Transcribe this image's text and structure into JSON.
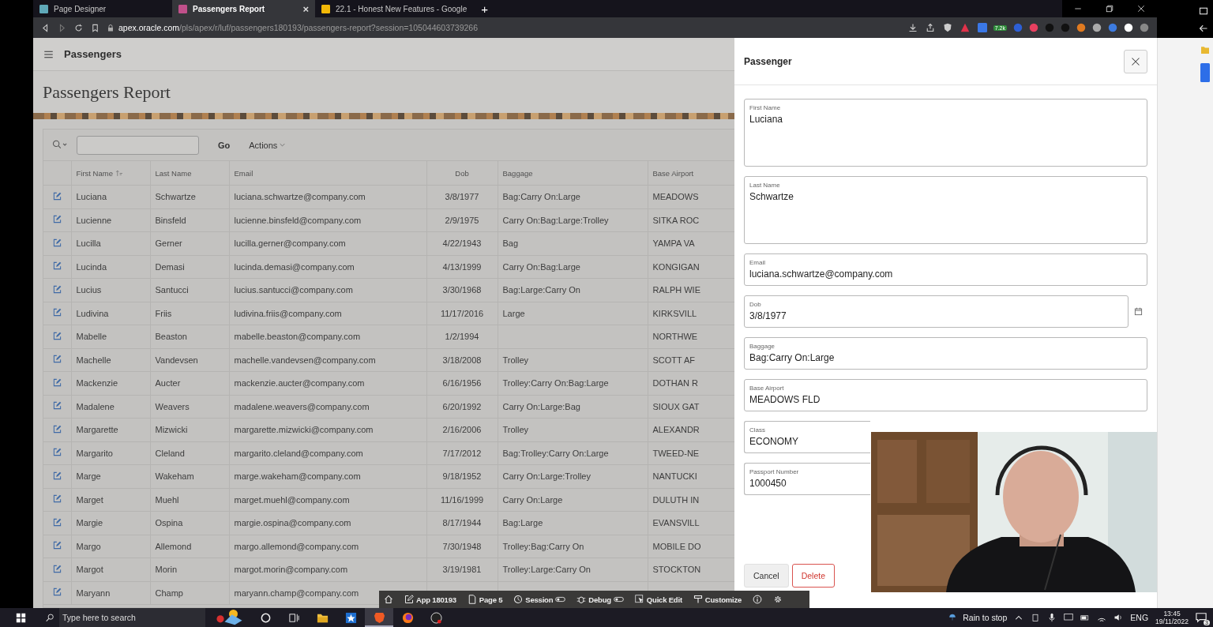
{
  "browser": {
    "tabs": [
      {
        "title": "Page Designer",
        "selected": false
      },
      {
        "title": "Passengers Report",
        "selected": true
      },
      {
        "title": "22.1 - Honest New Features - Google",
        "selected": false
      }
    ],
    "tab_close": "×",
    "new_tab": "+",
    "url": "**apex.oracle.com**/pls/apex/r/luf/passengers180193/passengers-report?session=105044603739266",
    "extension_badge": "7.2k"
  },
  "app": {
    "header_title": "Passengers",
    "page_title": "Passengers Report",
    "go": "Go",
    "actions": "Actions",
    "columns": [
      {
        "label": "First Name",
        "sorted": true
      },
      {
        "label": "Last Name",
        "sorted": false
      },
      {
        "label": "Email",
        "sorted": false
      },
      {
        "label": "Dob",
        "sorted": false
      },
      {
        "label": "Baggage",
        "sorted": false
      },
      {
        "label": "Base Airport",
        "sorted": false
      }
    ],
    "rows": [
      {
        "first_name": "Luciana",
        "last_name": "Schwartze",
        "email": "luciana.schwartze@company.com",
        "dob": "3/8/1977",
        "baggage": "Bag:Carry On:Large",
        "base_airport": "MEADOWS"
      },
      {
        "first_name": "Lucienne",
        "last_name": "Binsfeld",
        "email": "lucienne.binsfeld@company.com",
        "dob": "2/9/1975",
        "baggage": "Carry On:Bag:Large:Trolley",
        "base_airport": "SITKA ROC"
      },
      {
        "first_name": "Lucilla",
        "last_name": "Gerner",
        "email": "lucilla.gerner@company.com",
        "dob": "4/22/1943",
        "baggage": "Bag",
        "base_airport": "YAMPA VA"
      },
      {
        "first_name": "Lucinda",
        "last_name": "Demasi",
        "email": "lucinda.demasi@company.com",
        "dob": "4/13/1999",
        "baggage": "Carry On:Bag:Large",
        "base_airport": "KONGIGAN"
      },
      {
        "first_name": "Lucius",
        "last_name": "Santucci",
        "email": "lucius.santucci@company.com",
        "dob": "3/30/1968",
        "baggage": "Bag:Large:Carry On",
        "base_airport": "RALPH WIE"
      },
      {
        "first_name": "Ludivina",
        "last_name": "Friis",
        "email": "ludivina.friis@company.com",
        "dob": "11/17/2016",
        "baggage": "Large",
        "base_airport": "KIRKSVILL"
      },
      {
        "first_name": "Mabelle",
        "last_name": "Beaston",
        "email": "mabelle.beaston@company.com",
        "dob": "1/2/1994",
        "base_airport": "NORTHWE"
      },
      {
        "first_name": "Machelle",
        "last_name": "Vandevsen",
        "email": "machelle.vandevsen@company.com",
        "dob": "3/18/2008",
        "baggage": "Trolley",
        "base_airport": "SCOTT AF"
      },
      {
        "first_name": "Mackenzie",
        "last_name": "Aucter",
        "email": "mackenzie.aucter@company.com",
        "dob": "6/16/1956",
        "baggage": "Trolley:Carry On:Bag:Large",
        "base_airport": "DOTHAN R"
      },
      {
        "first_name": "Madalene",
        "last_name": "Weavers",
        "email": "madalene.weavers@company.com",
        "dob": "6/20/1992",
        "baggage": "Carry On:Large:Bag",
        "base_airport": "SIOUX GAT"
      },
      {
        "first_name": "Margarette",
        "last_name": "Mizwicki",
        "email": "margarette.mizwicki@company.com",
        "dob": "2/16/2006",
        "baggage": "Trolley",
        "base_airport": "ALEXANDR"
      },
      {
        "first_name": "Margarito",
        "last_name": "Cleland",
        "email": "margarito.cleland@company.com",
        "dob": "7/17/2012",
        "baggage": "Bag:Trolley:Carry On:Large",
        "base_airport": "TWEED-NE"
      },
      {
        "first_name": "Marge",
        "last_name": "Wakeham",
        "email": "marge.wakeham@company.com",
        "dob": "9/18/1952",
        "baggage": "Carry On:Large:Trolley",
        "base_airport": "NANTUCKI"
      },
      {
        "first_name": "Marget",
        "last_name": "Muehl",
        "email": "marget.muehl@company.com",
        "dob": "11/16/1999",
        "baggage": "Carry On:Large",
        "base_airport": "DULUTH IN"
      },
      {
        "first_name": "Margie",
        "last_name": "Ospina",
        "email": "margie.ospina@company.com",
        "dob": "8/17/1944",
        "baggage": "Bag:Large",
        "base_airport": "EVANSVILL"
      },
      {
        "first_name": "Margo",
        "last_name": "Allemond",
        "email": "margo.allemond@company.com",
        "dob": "7/30/1948",
        "baggage": "Trolley:Bag:Carry On",
        "base_airport": "MOBILE DO"
      },
      {
        "first_name": "Margot",
        "last_name": "Morin",
        "email": "margot.morin@company.com",
        "dob": "3/19/1981",
        "baggage": "Trolley:Large:Carry On",
        "base_airport": "STOCKTON"
      },
      {
        "first_name": "Maryann",
        "last_name": "Champ",
        "email": "maryann.champ@company.com"
      }
    ]
  },
  "dialog": {
    "title": "Passenger",
    "fields": [
      {
        "label": "First Name",
        "value": "Luciana",
        "kind": "textarea"
      },
      {
        "label": "Last Name",
        "value": "Schwartze",
        "kind": "textarea"
      },
      {
        "label": "Email",
        "value": "luciana.schwartze@company.com",
        "kind": "text"
      },
      {
        "label": "Dob",
        "value": "3/8/1977",
        "kind": "date"
      },
      {
        "label": "Baggage",
        "value": "Bag:Carry On:Large",
        "kind": "text"
      },
      {
        "label": "Base Airport",
        "value": "MEADOWS FLD",
        "kind": "text"
      },
      {
        "label": "Class",
        "value": "ECONOMY",
        "kind": "text"
      },
      {
        "label": "Passport Number",
        "value": "1000450",
        "kind": "text"
      }
    ],
    "buttons": [
      {
        "label": "Cancel",
        "kind": "secondary"
      },
      {
        "label": "Delete",
        "kind": "danger"
      }
    ]
  },
  "dev_toolbar": {
    "items": [
      {
        "kind": "home"
      },
      {
        "kind": "app",
        "label": "App 180193",
        "toggle": false
      },
      {
        "kind": "page",
        "label": "Page 5",
        "toggle": false
      },
      {
        "kind": "session",
        "label": "Session",
        "toggle": true
      },
      {
        "kind": "debug",
        "label": "Debug",
        "toggle": true
      },
      {
        "kind": "quickedit",
        "label": "Quick Edit",
        "toggle": false
      },
      {
        "kind": "customize",
        "label": "Customize",
        "toggle": false
      },
      {
        "kind": "info"
      },
      {
        "kind": "settings"
      }
    ]
  },
  "taskbar": {
    "search_placeholder": "Type here to search",
    "apps": [
      {
        "kind": "circle",
        "active": false
      },
      {
        "kind": "taskview",
        "active": false
      },
      {
        "kind": "folder",
        "active": false
      },
      {
        "kind": "store",
        "active": false
      },
      {
        "kind": "brave",
        "active": true
      },
      {
        "kind": "firefox",
        "active": false
      },
      {
        "kind": "obs",
        "active": false
      }
    ],
    "weather": "Rain to stop",
    "language": "ENG",
    "time": "13:45",
    "date": "19/11/2022",
    "notifications": "3"
  }
}
